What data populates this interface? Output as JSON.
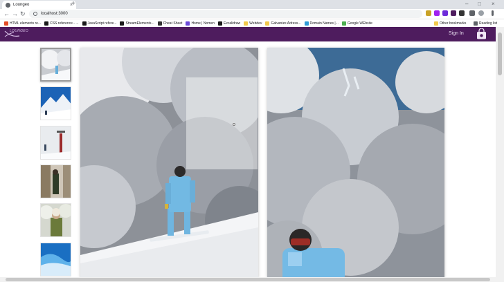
{
  "browser": {
    "tab_title": "Loungeo",
    "tab_close": "×",
    "new_tab": "+",
    "url": "localhost:3000",
    "window_controls": [
      "–",
      "□",
      "×"
    ],
    "nav": {
      "back": "←",
      "forward": "→",
      "reload": "↻"
    }
  },
  "bookmarks": [
    {
      "label": "HTML elements re...",
      "color": "#e34c26"
    },
    {
      "label": "CSS reference - ...",
      "color": "#1a1a1a"
    },
    {
      "label": "JavaScript refere...",
      "color": "#1a1a1a"
    },
    {
      "label": "StreamElements...",
      "color": "#1a1a1a"
    },
    {
      "label": "Cheat Sheet",
      "color": "#333333"
    },
    {
      "label": "Home | Nomen",
      "color": "#6c4cd9"
    },
    {
      "label": "Excalidraw",
      "color": "#1a1a1a"
    },
    {
      "label": "Webdev",
      "color": "#f2c94c"
    },
    {
      "label": "Galvanize Adress...",
      "color": "#f2c94c"
    },
    {
      "label": "Domain Names |...",
      "color": "#2f9bd6"
    },
    {
      "label": "Google WEbsite",
      "color": "#4caf50"
    }
  ],
  "bookmarks_right": {
    "other": "Other bookmarks",
    "reading": "Reading list"
  },
  "site": {
    "logo_text": "LOUNGEO",
    "signin_label": "Sign In",
    "bag_icon": "shopping-bag-icon",
    "brand_color": "#4e1c5e"
  },
  "product": {
    "thumbnails": [
      {
        "name": "snowboarder-clouds",
        "active": true
      },
      {
        "name": "mountain-snow",
        "active": false
      },
      {
        "name": "ski-lift-snow",
        "active": false
      },
      {
        "name": "person-snowy-forest",
        "active": false
      },
      {
        "name": "person-snowy-trees",
        "active": false
      },
      {
        "name": "blue-snow-waves",
        "active": false
      }
    ]
  }
}
